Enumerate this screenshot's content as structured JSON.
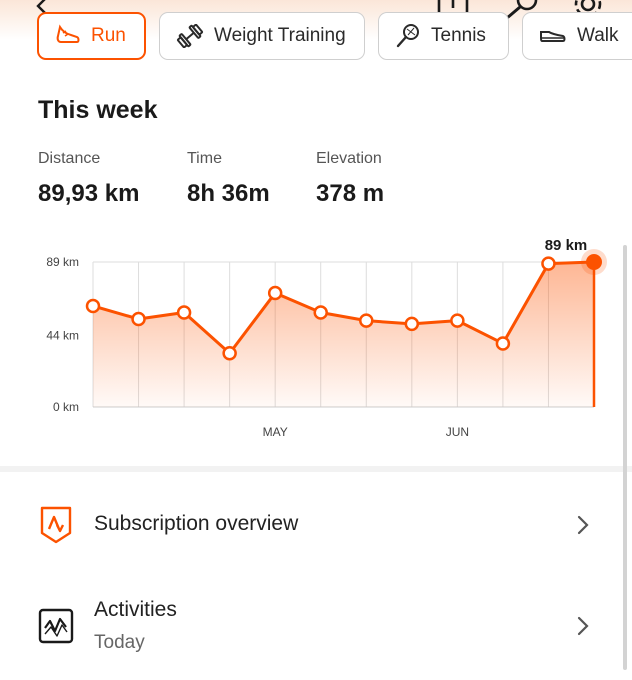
{
  "colors": {
    "accent": "#fc5200",
    "text": "#1a1a1a",
    "muted": "#555555",
    "grid": "#dddddd"
  },
  "top_icons": [
    "back-arrow-icon",
    "share-icon",
    "search-icon",
    "gear-icon"
  ],
  "sport_tabs": [
    {
      "label": "Run",
      "icon": "run-shoe-icon",
      "selected": true
    },
    {
      "label": "Weight Training",
      "icon": "dumbbell-icon",
      "selected": false
    },
    {
      "label": "Tennis",
      "icon": "tennis-racket-icon",
      "selected": false
    },
    {
      "label": "Walk",
      "icon": "walk-shoe-icon",
      "selected": false
    }
  ],
  "week": {
    "title": "This week",
    "stats": [
      {
        "label": "Distance",
        "value": "89,93 km"
      },
      {
        "label": "Time",
        "value": "8h 36m"
      },
      {
        "label": "Elevation",
        "value": "378 m"
      }
    ]
  },
  "chart_data": {
    "type": "area",
    "y_tick_labels": [
      "89 km",
      "44 km",
      "0 km"
    ],
    "y_ticks": [
      89,
      44,
      0
    ],
    "ylim": [
      0,
      89
    ],
    "x_month_labels": [
      {
        "label": "MAY",
        "index": 4
      },
      {
        "label": "JUN",
        "index": 8
      }
    ],
    "values": [
      62,
      54,
      58,
      33,
      70,
      58,
      53,
      51,
      53,
      39,
      88,
      89
    ],
    "current_label": "89 km",
    "grid": true
  },
  "menu": {
    "subscription": {
      "label": "Subscription overview",
      "icon": "strava-shield-icon"
    },
    "activities": {
      "label": "Activities",
      "sublabel": "Today",
      "icon": "activity-heartbeat-icon"
    }
  }
}
